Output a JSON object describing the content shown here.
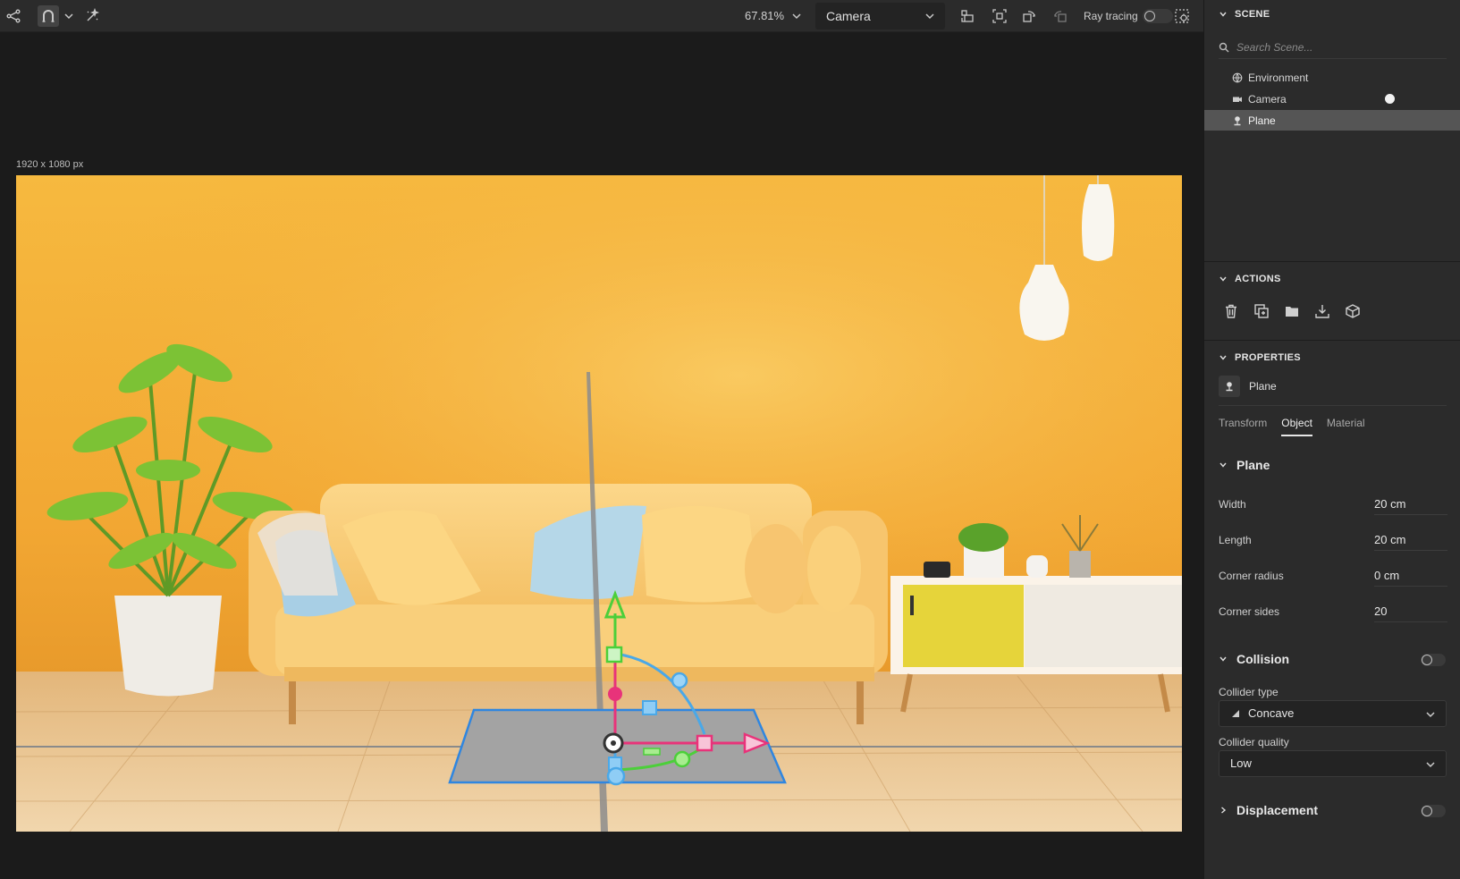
{
  "toolbar": {
    "zoom": "67.81%",
    "camera_select": "Camera",
    "ray_tracing_label": "Ray tracing",
    "ray_tracing_enabled": false
  },
  "viewport": {
    "resolution_label": "1920 x 1080 px"
  },
  "scene": {
    "title": "SCENE",
    "search_placeholder": "Search Scene...",
    "items": [
      {
        "label": "Environment",
        "icon": "globe-icon",
        "selected": false
      },
      {
        "label": "Camera",
        "icon": "camera-icon",
        "selected": false,
        "active": true
      },
      {
        "label": "Plane",
        "icon": "plane-object-icon",
        "selected": true
      }
    ]
  },
  "actions": {
    "title": "ACTIONS",
    "icons": [
      "trash-icon",
      "duplicate-icon",
      "folder-icon",
      "download-icon",
      "package-icon"
    ]
  },
  "properties": {
    "title": "PROPERTIES",
    "object_name": "Plane",
    "tabs": [
      "Transform",
      "Object",
      "Material"
    ],
    "active_tab": "Object",
    "plane_section": "Plane",
    "fields": [
      {
        "label": "Width",
        "value": "20 cm"
      },
      {
        "label": "Length",
        "value": "20 cm"
      },
      {
        "label": "Corner radius",
        "value": "0 cm"
      },
      {
        "label": "Corner sides",
        "value": "20"
      }
    ],
    "collision": {
      "title": "Collision",
      "enabled": false,
      "collider_type_label": "Collider type",
      "collider_type": "Concave",
      "collider_quality_label": "Collider quality",
      "collider_quality": "Low"
    },
    "displacement": {
      "title": "Displacement",
      "enabled": false
    }
  },
  "colors": {
    "gizmo_x": "#e8337a",
    "gizmo_y": "#4ccf3a",
    "gizmo_z": "#4aa8e8",
    "wall": "#f4b43a",
    "panel_bg": "#2b2b2b"
  }
}
